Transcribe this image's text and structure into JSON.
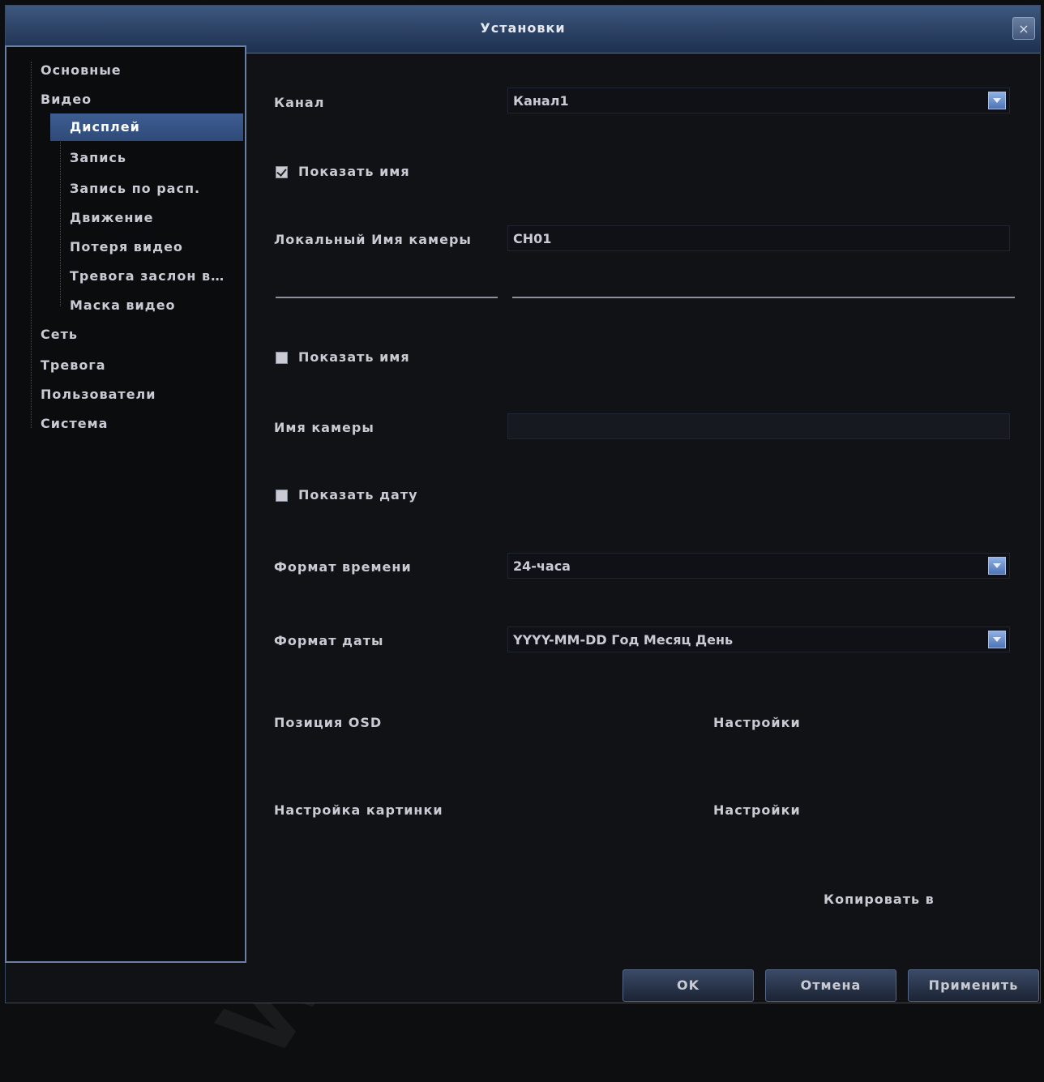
{
  "window": {
    "title": "Установки",
    "close_symbol": "×"
  },
  "sidebar": {
    "items": [
      {
        "label": "Основные",
        "level": 0
      },
      {
        "label": "Видео",
        "level": 0
      },
      {
        "label": "Дисплей",
        "level": 1,
        "selected": true
      },
      {
        "label": "Запись",
        "level": 1
      },
      {
        "label": "Запись по расп.",
        "level": 1
      },
      {
        "label": "Движение",
        "level": 1
      },
      {
        "label": "Потеря видео",
        "level": 1
      },
      {
        "label": "Тревога заслон в…",
        "level": 1
      },
      {
        "label": "Маска видео",
        "level": 1
      },
      {
        "label": "Сеть",
        "level": 0
      },
      {
        "label": "Тревога",
        "level": 0
      },
      {
        "label": "Пользователи",
        "level": 0
      },
      {
        "label": "Система",
        "level": 0
      }
    ]
  },
  "form": {
    "channel": {
      "label": "Канал",
      "value": "Канал1"
    },
    "show_name_1": {
      "label": "Показать имя",
      "checked": true
    },
    "local_camera_name": {
      "label": "Локальный Имя камеры",
      "value": "CH01"
    },
    "show_name_2": {
      "label": "Показать имя",
      "checked": false
    },
    "camera_name": {
      "label": "Имя камеры",
      "value": ""
    },
    "show_date": {
      "label": "Показать дату",
      "checked": false
    },
    "time_format": {
      "label": "Формат времени",
      "value": "24-часа"
    },
    "date_format": {
      "label": "Формат даты",
      "value": "YYYY-MM-DD Год Месяц День"
    },
    "osd_position": {
      "label": "Позиция OSD",
      "button": "Настройки"
    },
    "picture_settings": {
      "label": "Настройка картинки",
      "button": "Настройки"
    },
    "copy_to": {
      "label": "Копировать в"
    }
  },
  "buttons": {
    "ok": "OK",
    "cancel": "Отмена",
    "apply": "Применить"
  },
  "watermark": "www.Cyfron.ru",
  "colors": {
    "titlebar": "#2e4568",
    "selected": "#3e5d92",
    "background": "#111215",
    "text": "#c9cbd4"
  }
}
